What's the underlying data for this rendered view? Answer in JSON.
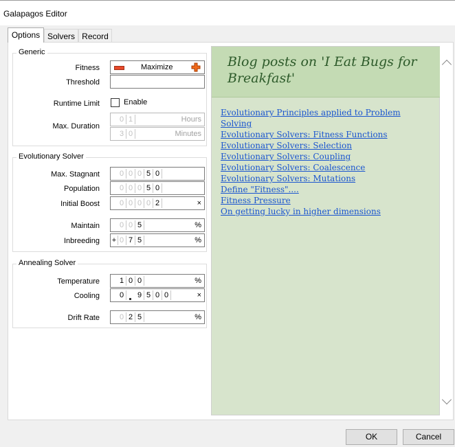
{
  "window": {
    "title": "Galapagos Editor"
  },
  "tabs": [
    {
      "label": "Options"
    },
    {
      "label": "Solvers"
    },
    {
      "label": "Record"
    }
  ],
  "generic": {
    "group_title": "Generic",
    "fitness_label": "Fitness",
    "fitness_value": "Maximize",
    "threshold_label": "Threshold",
    "threshold_value": "",
    "runtime_label": "Runtime Limit",
    "runtime_enable": "Enable",
    "duration_label": "Max. Duration",
    "hours": {
      "digits": [
        "0",
        "1"
      ],
      "unit": "Hours"
    },
    "minutes": {
      "digits": [
        "3",
        "0"
      ],
      "unit": "Minutes"
    }
  },
  "evo": {
    "group_title": "Evolutionary Solver",
    "stagnant_label": "Max. Stagnant",
    "stagnant_digits": [
      "0",
      "0",
      "0",
      "5",
      "0"
    ],
    "population_label": "Population",
    "population_digits": [
      "0",
      "0",
      "0",
      "5",
      "0"
    ],
    "boost_label": "Initial Boost",
    "boost_digits": [
      "0",
      "0",
      "0",
      "0",
      "2"
    ],
    "boost_unit": "×",
    "maintain_label": "Maintain",
    "maintain_digits": [
      "0",
      "0",
      "5"
    ],
    "maintain_unit": "%",
    "inbreeding_label": "Inbreeding",
    "inbreeding_sign": "+",
    "inbreeding_digits": [
      "0",
      "7",
      "5"
    ],
    "inbreeding_unit": "%"
  },
  "anneal": {
    "group_title": "Annealing Solver",
    "temperature_label": "Temperature",
    "temperature_digits": [
      "1",
      "0",
      "0"
    ],
    "temperature_unit": "%",
    "cooling_label": "Cooling",
    "cooling_int": "0",
    "cooling_digits": [
      "9",
      "5",
      "0",
      "0"
    ],
    "cooling_unit": "×",
    "drift_label": "Drift Rate",
    "drift_digits": [
      "0",
      "2",
      "5"
    ],
    "drift_unit": "%"
  },
  "blog": {
    "title": "Blog posts on 'I Eat Bugs for Breakfast'",
    "links": [
      "Evolutionary Principles applied to Problem Solving",
      "Evolutionary Solvers: Fitness Functions",
      "Evolutionary Solvers: Selection",
      "Evolutionary Solvers: Coupling",
      "Evolutionary Solvers: Coalescence",
      "Evolutionary Solvers: Mutations",
      "Define \"Fitness\"....",
      "Fitness Pressure",
      "On getting lucky in higher dimensions"
    ]
  },
  "buttons": {
    "ok": "OK",
    "cancel": "Cancel"
  }
}
